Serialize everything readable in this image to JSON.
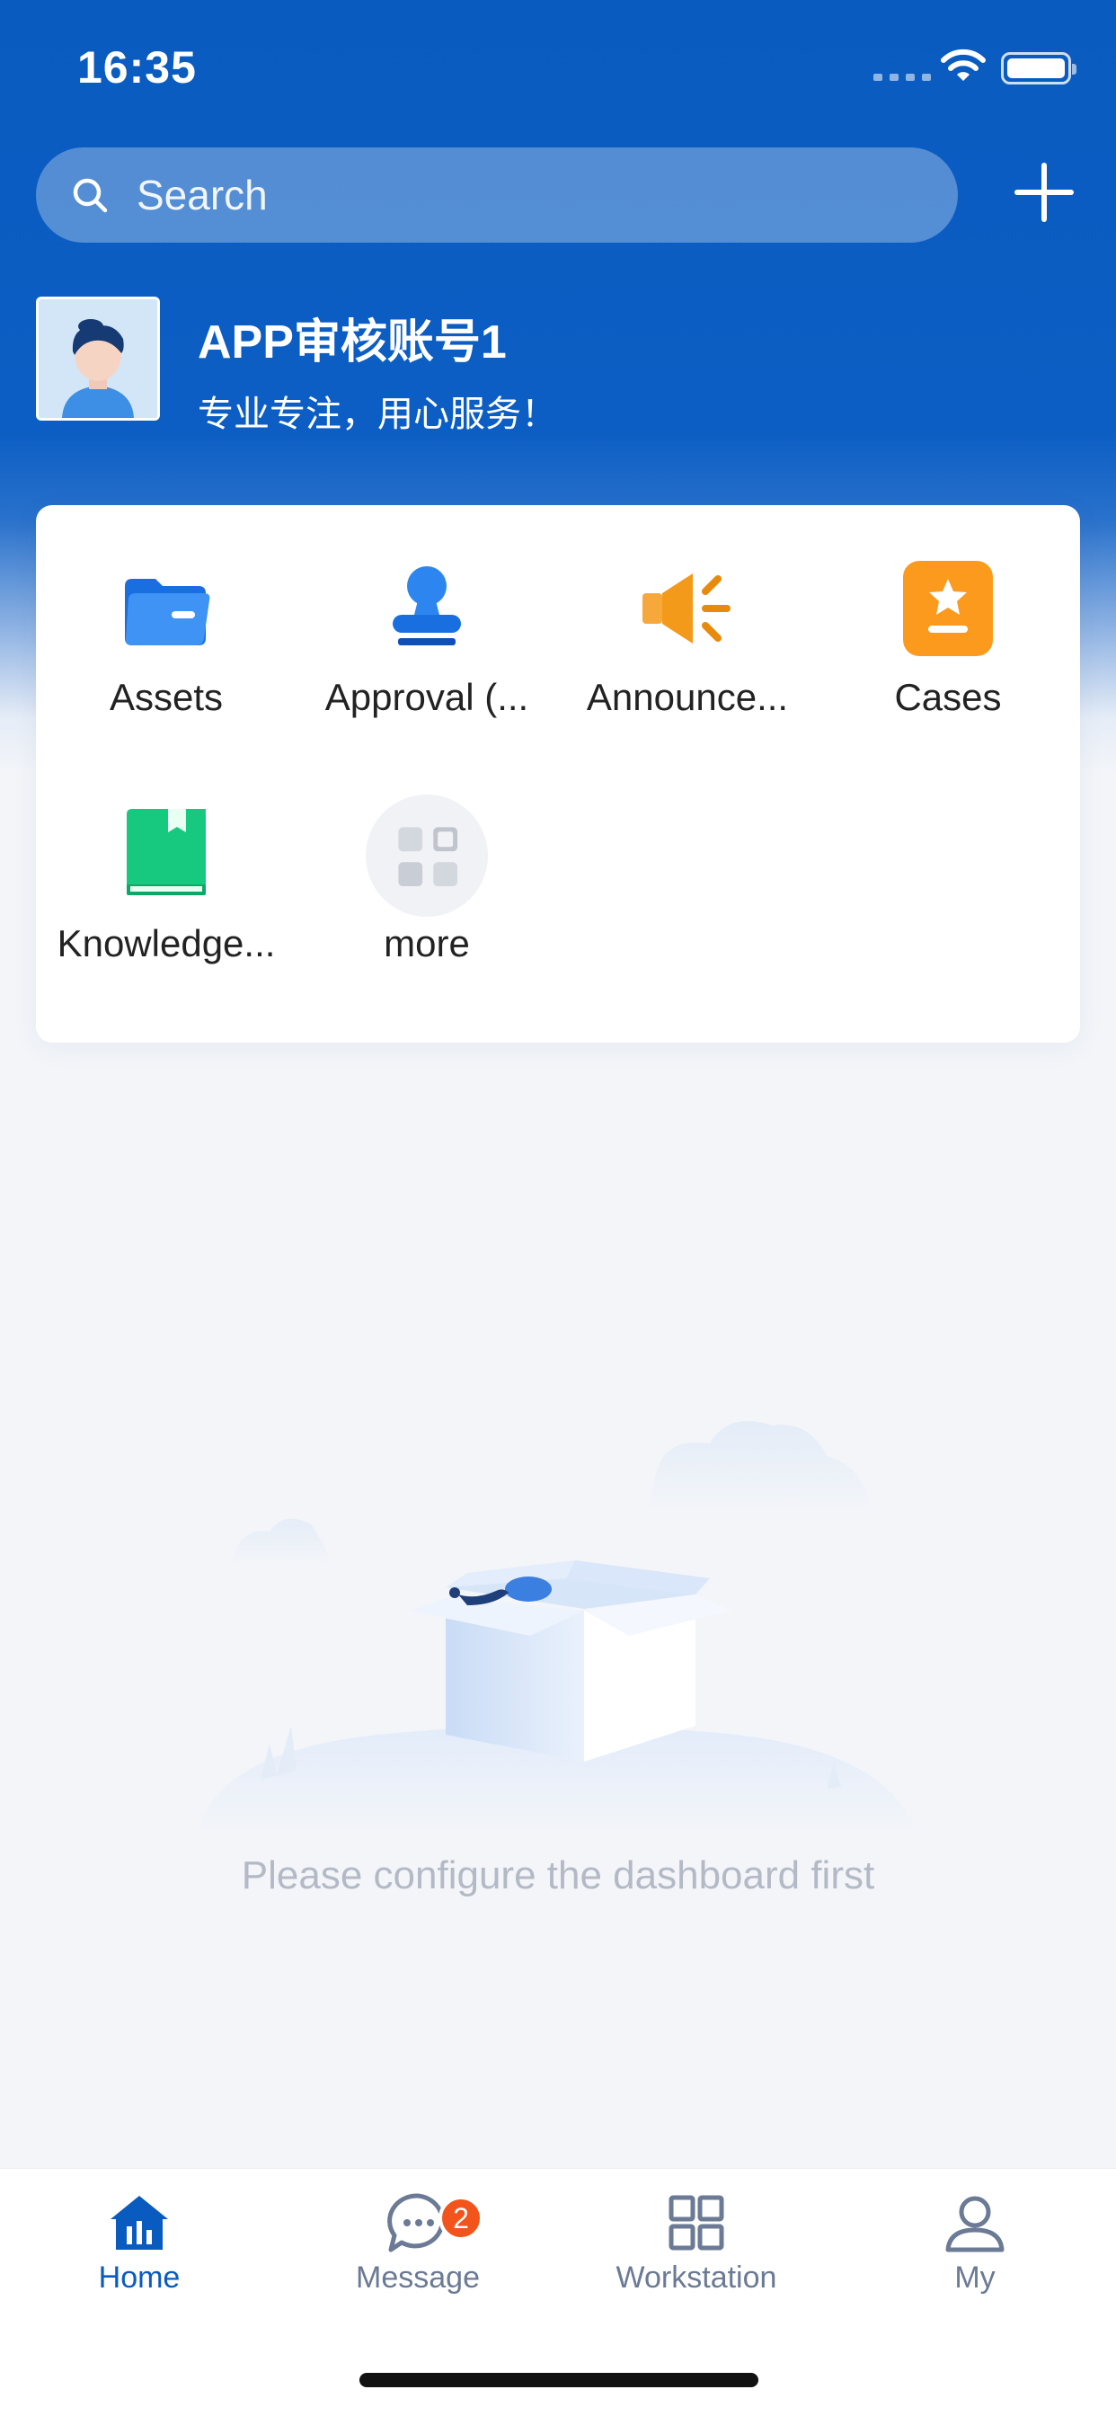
{
  "status_bar": {
    "time": "16:35"
  },
  "search": {
    "placeholder": "Search"
  },
  "profile": {
    "name": "APP审核账号1",
    "motto": "专业专注，用心服务！"
  },
  "apps": [
    {
      "label": "Assets",
      "icon": "folder-icon",
      "color": "#1f7ef0"
    },
    {
      "label": "Approval (...",
      "icon": "stamp-icon",
      "color": "#1a6fe0"
    },
    {
      "label": "Announce...",
      "icon": "megaphone-icon",
      "color": "#f39a1b"
    },
    {
      "label": "Cases",
      "icon": "star-card-icon",
      "color": "#fb9a1c"
    },
    {
      "label": "Knowledge...",
      "icon": "book-icon",
      "color": "#14c07a"
    },
    {
      "label": "more",
      "icon": "grid-more-icon",
      "color": "#c9cdd6"
    }
  ],
  "empty_state": {
    "message": "Please configure the dashboard first"
  },
  "tabs": [
    {
      "label": "Home",
      "icon": "home-icon",
      "active": true
    },
    {
      "label": "Message",
      "icon": "chat-icon",
      "badge": "2"
    },
    {
      "label": "Workstation",
      "icon": "grid-icon"
    },
    {
      "label": "My",
      "icon": "user-icon"
    }
  ],
  "colors": {
    "brand": "#0a5bc0",
    "badge": "#f2541b",
    "tab_inactive": "#6b7a95"
  }
}
